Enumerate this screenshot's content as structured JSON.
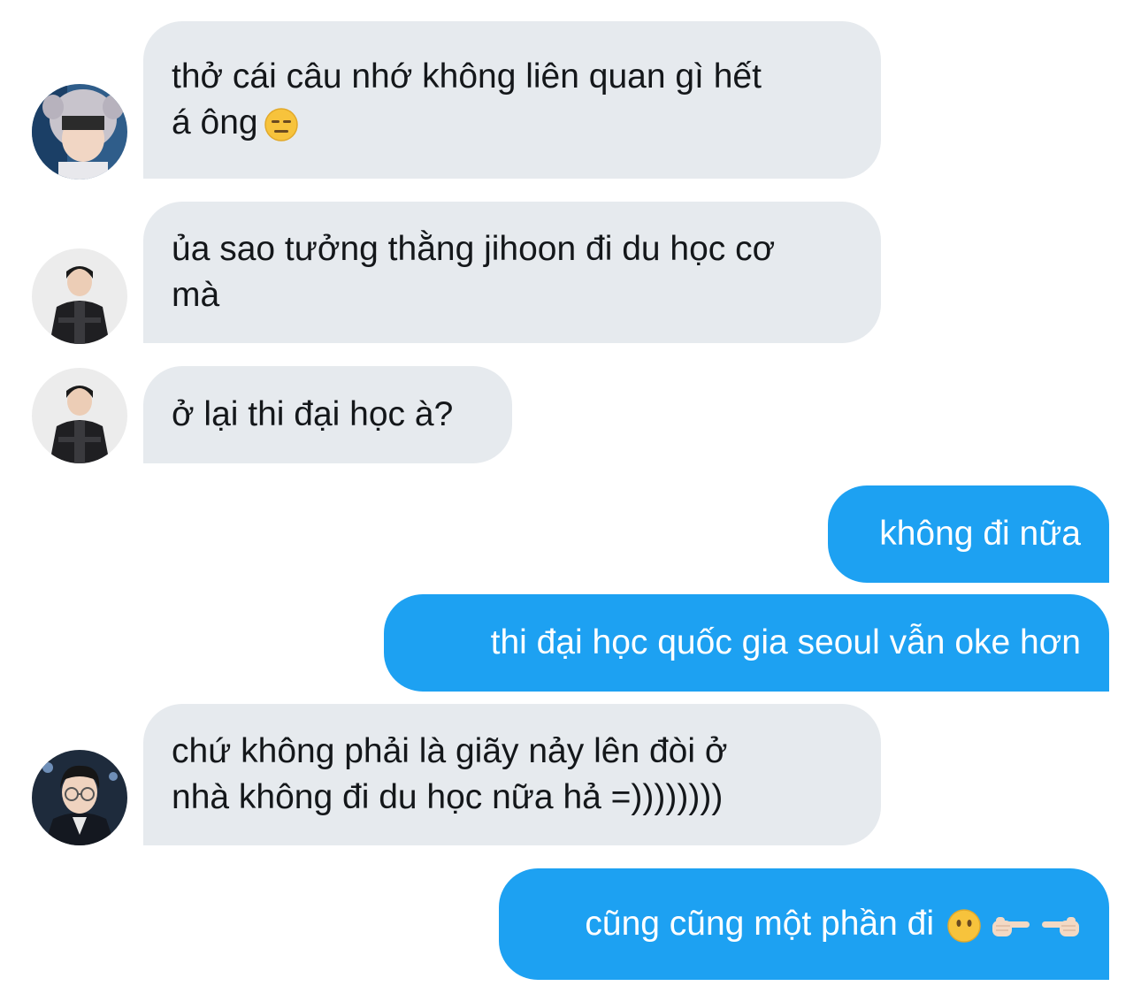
{
  "conversation": {
    "messages": [
      {
        "direction": "incoming",
        "sender": "avatar-beanie",
        "text": "thở cái câu nhớ không liên quan gì hết\ná ông",
        "emoji": "expressionless-face"
      },
      {
        "direction": "incoming",
        "sender": "avatar-jacket",
        "text": "ủa sao tưởng thằng jihoon đi du học cơ\nmà"
      },
      {
        "direction": "incoming",
        "sender": "avatar-jacket",
        "text": "ở lại thi đại học à?"
      },
      {
        "direction": "outgoing",
        "text": "không đi nữa"
      },
      {
        "direction": "outgoing",
        "text": "thi đại học quốc gia seoul vẫn oke hơn"
      },
      {
        "direction": "incoming",
        "sender": "avatar-glasses",
        "text": "chứ không phải là giãy nảy lên đòi ở\nnhà không đi du học nữa hả =))))))))"
      },
      {
        "direction": "outgoing",
        "text": "cũng cũng một phần đi",
        "emojis": [
          "face-without-mouth",
          "pointing-right-hand",
          "pointing-left-hand"
        ]
      }
    ]
  },
  "colors": {
    "incoming_bubble": "#e6eaee",
    "outgoing_bubble": "#1da1f2",
    "incoming_text": "#14171a",
    "outgoing_text": "#ffffff"
  }
}
